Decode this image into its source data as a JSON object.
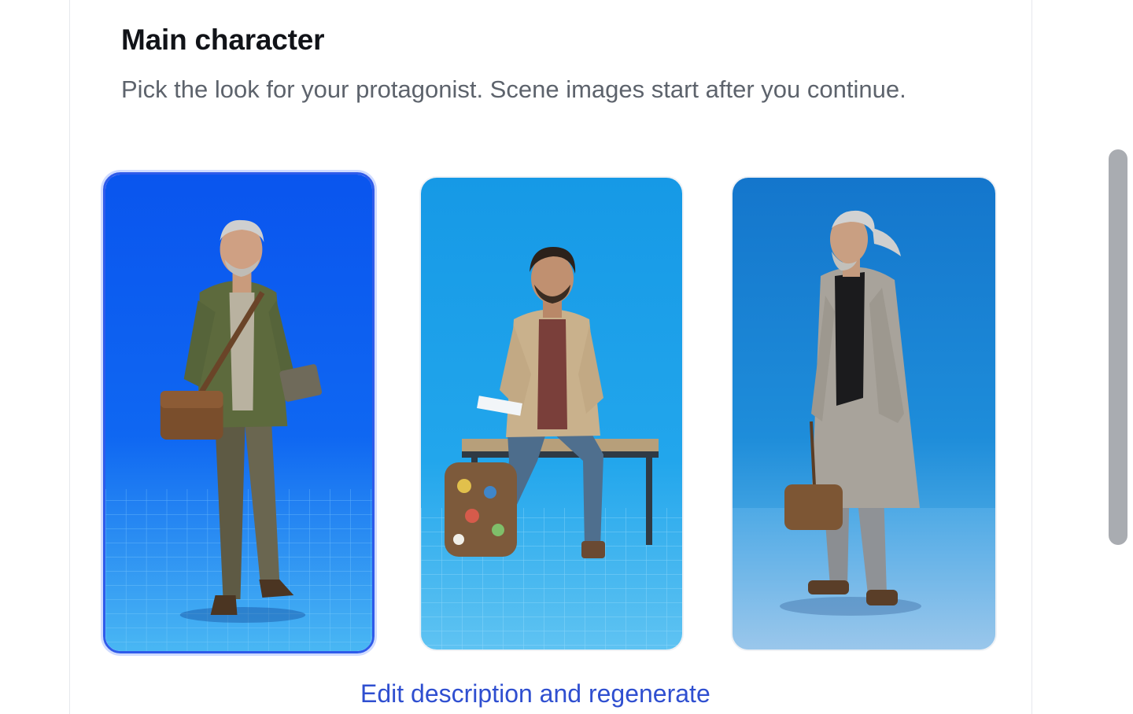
{
  "section": {
    "title": "Main character",
    "subtitle": "Pick the look for your protagonist. Scene images start after you continue."
  },
  "options": [
    {
      "selected": true,
      "background": "#0a5cf0",
      "icon": "character-portrait-green-jacket"
    },
    {
      "selected": false,
      "background": "#1fa0ea",
      "icon": "character-portrait-seated-bench"
    },
    {
      "selected": false,
      "background": "#1e88d6",
      "icon": "character-portrait-grey-coat"
    }
  ],
  "actions": {
    "edit_link": "Edit description and regenerate"
  },
  "colors": {
    "accent": "#2f5bea",
    "link": "#2f4fd0",
    "title": "#111318",
    "subtitle": "#5d636c"
  }
}
